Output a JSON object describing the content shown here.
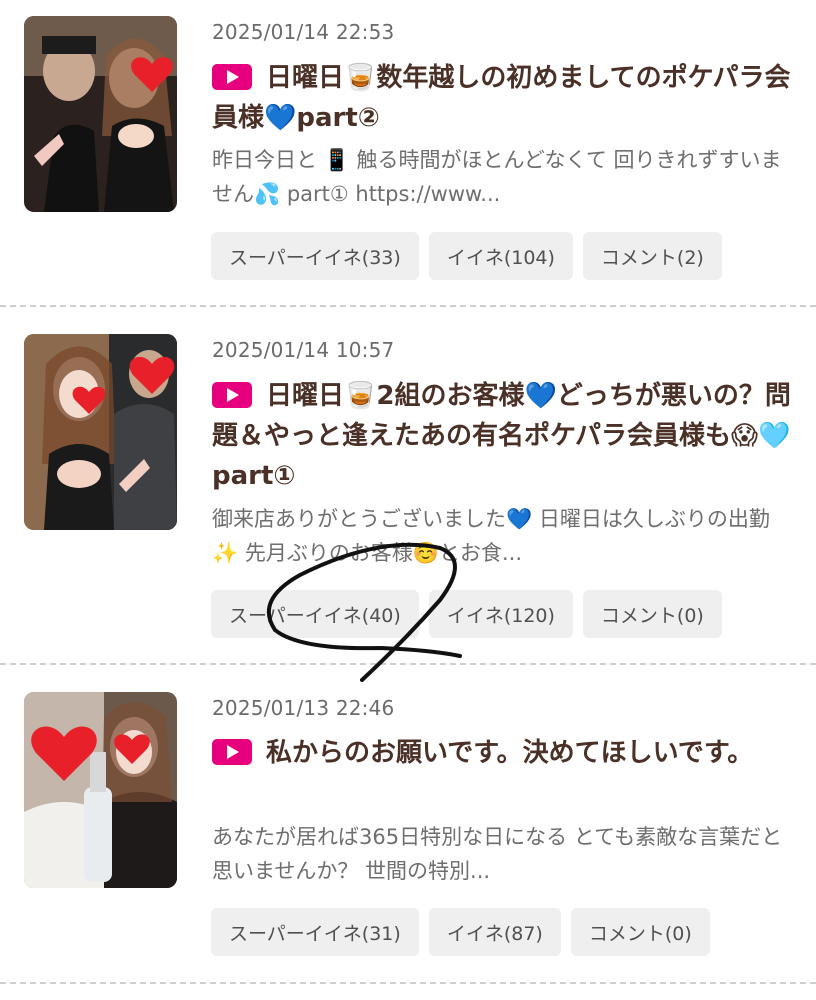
{
  "posts": [
    {
      "date": "2025/01/14 22:53",
      "title": "日曜日🥃数年越しの初めましてのポケパラ会員様💙part②",
      "excerpt": "昨日今日と 📱 触る時間がほとんどなくて 回りきれずすいません💦 part① https://www...",
      "tags": [
        "スーパーイイネ(33)",
        "イイネ(104)",
        "コメント(2)"
      ],
      "thumb_icon": "photo-thumbnail-icon"
    },
    {
      "date": "2025/01/14 10:57",
      "title": "日曜日🥃2組のお客様💙どっちが悪いの？問題＆やっと逢えたあの有名ポケパラ会員様も😱🩵part①",
      "excerpt": " 御来店ありがとうございました💙 日曜日は久しぶりの出勤✨ 先月ぶりのお客様☺️とお食...",
      "tags": [
        "スーパーイイネ(40)",
        "イイネ(120)",
        "コメント(0)"
      ],
      "thumb_icon": "photo-thumbnail-icon"
    },
    {
      "date": "2025/01/13 22:46",
      "title": "私からのお願いです。決めてほしいです。",
      "excerpt": "あなたが居れば365日特別な日になる とても素敵な言葉だと思いませんか？ 世間の特別...",
      "tags": [
        "スーパーイイネ(31)",
        "イイネ(87)",
        "コメント(0)"
      ],
      "thumb_icon": "photo-thumbnail-icon"
    }
  ],
  "colors": {
    "accent": "#e6007e",
    "title": "#4a3026",
    "tag_bg": "#efefef",
    "heart": "#e8202a"
  }
}
